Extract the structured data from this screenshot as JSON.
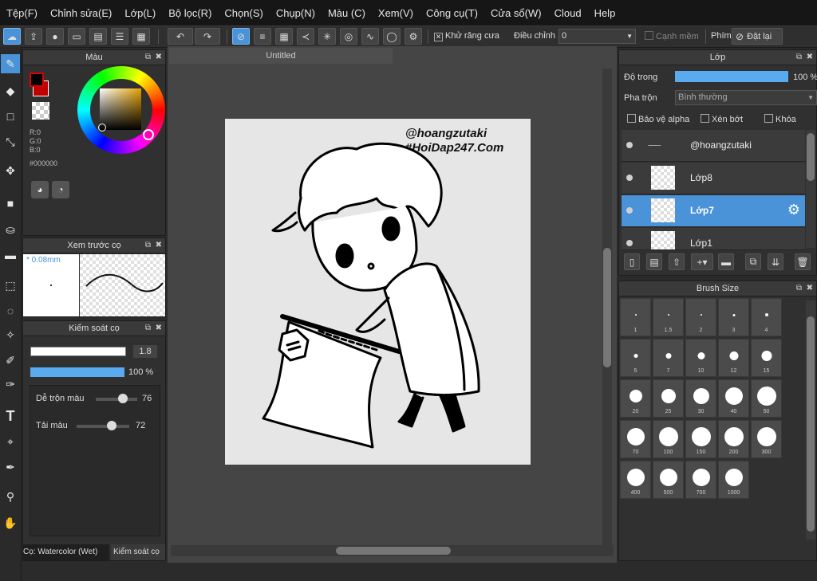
{
  "menu": [
    "Tệp(F)",
    "Chỉnh sửa(E)",
    "Lớp(L)",
    "Bộ lọc(R)",
    "Chọn(S)",
    "Chụp(N)",
    "Màu (C)",
    "Xem(V)",
    "Công cụ(T)",
    "Cửa sổ(W)",
    "Cloud",
    "Help"
  ],
  "toolbar": {
    "antialias_label": "Khử răng cưa",
    "antialias_check": "✕",
    "adjust_label": "Điều chỉnh",
    "adjust_value": "0",
    "soft_edge_label": "Cạnh mềm",
    "key_label": "Phím",
    "reset_label": "Đặt lại"
  },
  "color_panel": {
    "title": "Màu",
    "rgb": [
      "R:0",
      "G:0",
      "B:0"
    ],
    "hex": "#000000"
  },
  "brush_preview": {
    "title": "Xem trước cọ",
    "size": "* 0.08mm"
  },
  "brush_control": {
    "title": "Kiểm soát cọ",
    "size_value": "1.8",
    "opacity_value": "100 %",
    "blend_label": "Dễ trộn màu",
    "blend_value": "76",
    "amount_label": "Tải màu",
    "amount_value": "72",
    "tab_active": "Cọ: Watercolor (Wet)",
    "tab_other": "Kiểm soát cọ"
  },
  "document": {
    "tab": "Untitled",
    "watermark_line1": "@hoangzutaki",
    "watermark_line2": "#HoiDap247.Com"
  },
  "layer_panel": {
    "title": "Lớp",
    "opacity_label": "Độ trong",
    "opacity_value": "100 %",
    "blend_label": "Pha trộn",
    "blend_value": "Bình thường",
    "protect_alpha": "Bảo vệ alpha",
    "clipping": "Xén bớt",
    "lock": "Khóa",
    "layers": [
      {
        "name": "@hoangzutaki",
        "selected": false
      },
      {
        "name": "Lớp8",
        "selected": false
      },
      {
        "name": "Lớp7",
        "selected": true
      },
      {
        "name": "Lớp1",
        "selected": false
      }
    ]
  },
  "brush_size_panel": {
    "title": "Brush Size",
    "sizes": [
      "1",
      "1.5",
      "2",
      "3",
      "4",
      "5",
      "7",
      "10",
      "12",
      "15",
      "20",
      "25",
      "30",
      "40",
      "50",
      "70",
      "100",
      "150",
      "200",
      "300",
      "400",
      "500",
      "700",
      "1000"
    ]
  },
  "colors": {
    "accent": "#4a93d8",
    "background": "#2b2b2b"
  }
}
